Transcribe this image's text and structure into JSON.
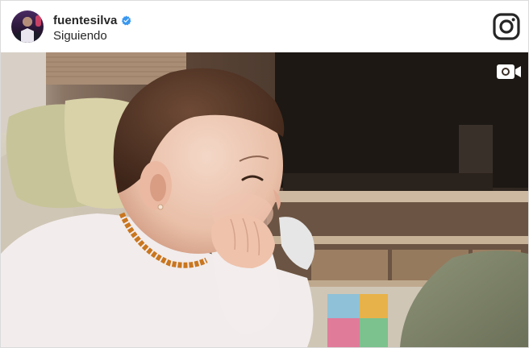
{
  "post": {
    "username": "fuentesilva",
    "verified": true,
    "follow_status": "Siguiendo",
    "media_type": "video"
  },
  "icons": {
    "verified": "verified-badge-icon",
    "platform": "instagram-logo-icon",
    "media": "video-camera-icon"
  },
  "colors": {
    "verified_badge": "#3897f0",
    "text": "#262626",
    "border": "#dbdbdb"
  }
}
